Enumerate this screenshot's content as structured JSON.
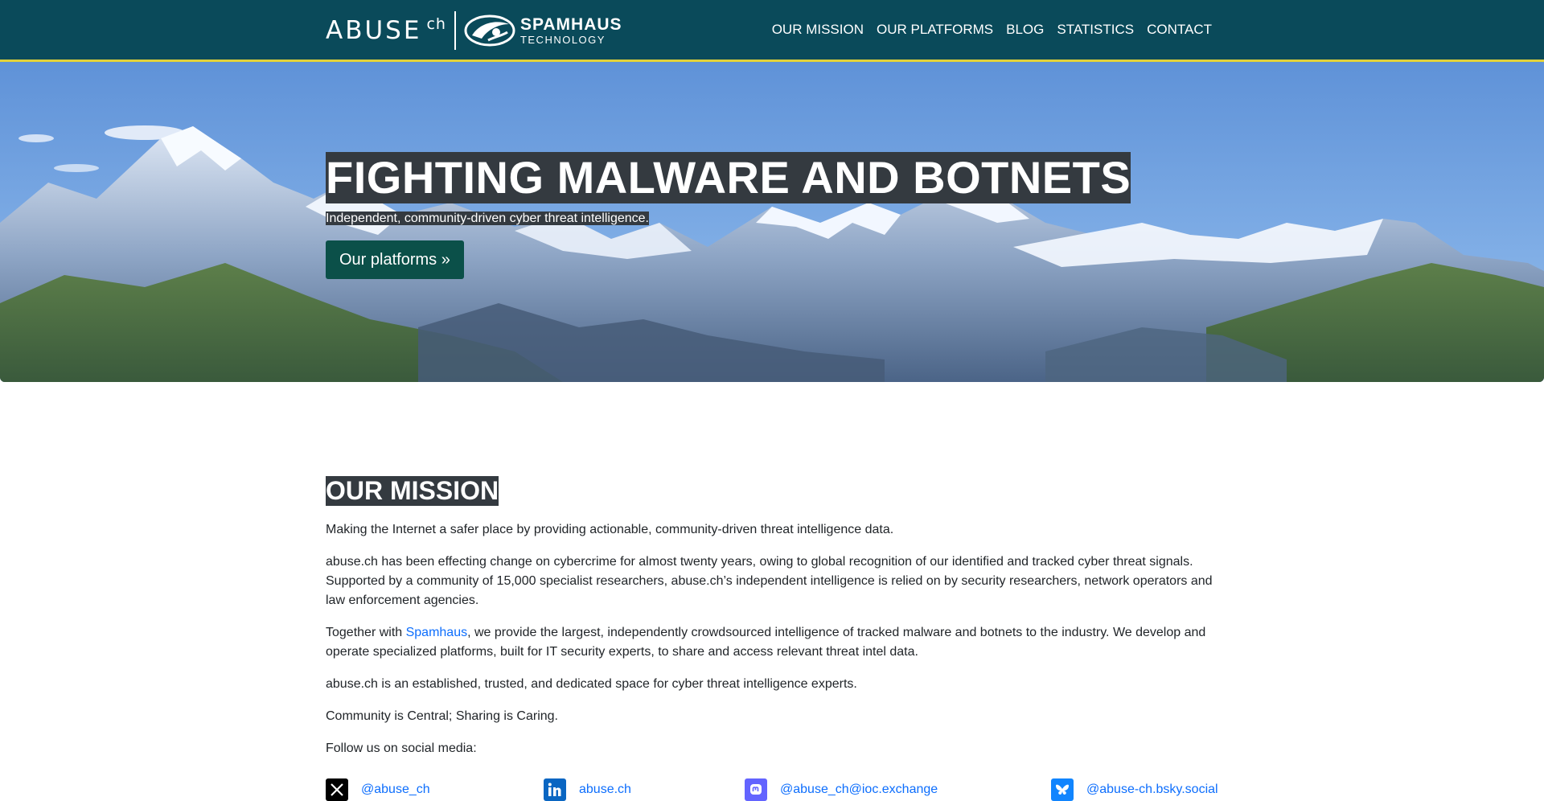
{
  "header": {
    "logo_abuse": "ABUSE",
    "logo_ch": "ch",
    "logo_spamhaus": "SPAMHAUS",
    "logo_technology": "TECHNOLOGY",
    "nav": [
      {
        "label": "OUR MISSION"
      },
      {
        "label": "OUR PLATFORMS"
      },
      {
        "label": "BLOG"
      },
      {
        "label": "STATISTICS"
      },
      {
        "label": "CONTACT"
      }
    ]
  },
  "hero": {
    "title": "FIGHTING MALWARE AND BOTNETS",
    "subtitle": "Independent, community-driven cyber threat intelligence.",
    "button": "Our platforms »"
  },
  "mission": {
    "title": "OUR MISSION",
    "p1": "Making the Internet a safer place by providing actionable, community-driven threat intelligence data.",
    "p2": "abuse.ch has been effecting change on cybercrime for almost twenty years, owing to global recognition of our identified and tracked cyber threat signals. Supported by a community of 15,000 specialist researchers, abuse.ch’s independent intelligence is relied on by security researchers, network operators and law enforcement agencies.",
    "p3_before": "Together with ",
    "p3_link": "Spamhaus",
    "p3_after": ", we provide the largest, independently crowdsourced intelligence of tracked malware and botnets to the industry. We develop and operate specialized platforms, built for IT security experts, to share and access relevant threat intel data.",
    "p4": "abuse.ch is an established, trusted, and dedicated space for cyber threat intelligence experts.",
    "p5": "Community is Central; Sharing is Caring.",
    "p6": "Follow us on social media:"
  },
  "socials": [
    {
      "icon": "x-icon",
      "label": "@abuse_ch",
      "color": "#000000"
    },
    {
      "icon": "linkedin-icon",
      "label": "abuse.ch",
      "color": "#0a66c2"
    },
    {
      "icon": "mastodon-icon",
      "label": "@abuse_ch@ioc.exchange",
      "color": "#6364ff"
    },
    {
      "icon": "bluesky-icon",
      "label": "@abuse-ch.bsky.social",
      "color": "#1185fe"
    }
  ],
  "colors": {
    "navbar": "#0a4a5a",
    "navbar_border": "#e2d23a",
    "link": "#0d6efd",
    "button": "#0b5049",
    "title_bg": "#343a40"
  }
}
